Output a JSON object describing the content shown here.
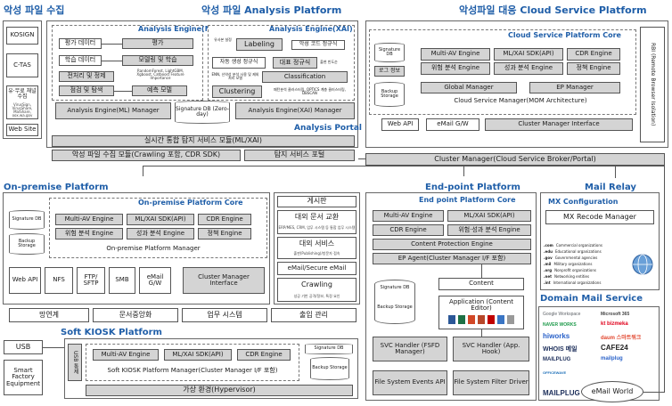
{
  "top": {
    "collect_title": "악성 파일 수집",
    "platform_title": "악성 파일 Analysis Platform",
    "cloud_title": "악성파일 대응 Cloud Service Platform"
  },
  "collect": {
    "kosign": "KOSIGN",
    "ctas": "C-TAS",
    "channel": "유·무료 채널 수집",
    "channel_sub": "VirusSign, VirusShare, MalShare, oox.wa.gov",
    "website": "Web Site"
  },
  "ml": {
    "title": "Analysis Engine(ML)",
    "eval_data": "평가 데이터",
    "eval": "평가",
    "train_data": "학습 데이터",
    "modeling": "모델링 및 학습",
    "models": "RandomForest, LightGBM, Xgboost, Catboost Feature Importance",
    "preproc": "전처리 및 정제",
    "check": "점검 및 탐색",
    "predict": "예측 모델",
    "manager": "Analysis Engine(ML) Manager"
  },
  "xai": {
    "title": "Analysis Engine(XAI)",
    "labeling_left": "유사본 설정",
    "labeling": "Labeling",
    "rule_sel": "악성 코드 정규식",
    "auto_regex": "자동 생성 정규식",
    "main_regex": "대표 정규식",
    "main_regex_sub": "출현 빈도순",
    "classif_left": "ENN, 신약성 분석 사용 및 제외 처리 모델",
    "classification": "Classification",
    "clustering": "Clustering",
    "cluster_sub": "패턴분석 클러스터링, OPTICS 계층 클러스터링, DBSCAN",
    "manager": "Analysis Engine(XAI) Manager"
  },
  "sigdb_zero": "Signature DB (Zero-day)",
  "portal": {
    "title": "Analysis Portal",
    "realtime": "실시간 통합 탐지 서비스 모듈(ML/XAI)",
    "collect_module": "악성 파일 수집 모듈(Crawling 포함, CDR SDK)",
    "detect_portal": "탐지 서비스 포털"
  },
  "cloud": {
    "core_title": "Cloud Service Platform Core",
    "sigdb": "Signature DB",
    "log": "로그 정보",
    "backup": "Backup Storage",
    "multi_av": "Multi-AV Engine",
    "mlxai": "ML/XAI SDK(API)",
    "cdr": "CDR Engine",
    "risk": "위험 분석 Engine",
    "perf": "성과 분석 Engine",
    "policy": "정책 Engine",
    "global": "Global Manager",
    "ep": "EP Manager",
    "csm": "Cloud Service Manager(MOM Architecture)",
    "webapi": "Web API",
    "email_gw": "eMail G/W",
    "cmi": "Cluster Manager Interface",
    "rbi": "RBI (Remote Browser Isolation)"
  },
  "cluster_manager": "Cluster Manager(Cloud Service Broker/Portal)",
  "onprem": {
    "title": "On-premise Platform",
    "core_title": "On-premise Platform Core",
    "sigdb": "Signature DB",
    "backup": "Backup Storage",
    "multi_av": "Multi-AV Engine",
    "mlxai": "ML/XAI SDK(API)",
    "cdr": "CDR Engine",
    "risk": "위험 분석 Engine",
    "perf": "성과 분석 Engine",
    "policy": "정책 Engine",
    "manager": "On-premise Platform Manager",
    "webapi": "Web API",
    "nfs": "NFS",
    "ftp": "FTP/ SFTP",
    "smb": "SMB",
    "email_gw": "eMail G/W",
    "cmi": "Cluster Manager Interface"
  },
  "services": {
    "board": "게시판",
    "doc_exchange": "대외 문서 교환",
    "doc_exchange_sub": "ERP/MES, CRM, 업무 시스템 등 통합 업무 시스템",
    "ext_service": "대외 서비스",
    "ext_service_sub": "출판(Publishing)/방문자 접속",
    "email_secure": "eMail/Secure eMail",
    "crawling": "Crawling",
    "crawling_sub": "성공 기반 공격/정보, 특정 요인"
  },
  "bottom_row": {
    "network": "망연계",
    "docs": "문서중앙화",
    "business": "업무 시스템",
    "access": "출입 관리"
  },
  "kiosk": {
    "title": "Soft KIOSK Platform",
    "usb": "USB",
    "smart": "Smart Factory Equipment",
    "usb_vert": "USB 통제",
    "multi_av": "Multi-AV Engine",
    "mlxai": "ML/XAI SDK(API)",
    "cdr": "CDR Engine",
    "manager": "Soft KIOSK Platform Manager(Cluster Manager I/F 포함)",
    "sigdb": "Signature DB",
    "backup": "Backup Storage",
    "hypervisor": "가상 환경(Hypervisor)"
  },
  "endpoint": {
    "title": "End-point Platform",
    "core_title": "End point Platform Core",
    "multi_av": "Multi-AV Engine",
    "mlxai": "ML/XAI SDK(API)",
    "cdr": "CDR Engine",
    "risk_perf": "위험·성과 분석 Engine",
    "cpe": "Content Protection Engine",
    "ep_agent": "EP Agent(Cluster Manager I/F 포함)",
    "sigdb": "Signature DB",
    "backup": "Backup Storage",
    "content": "Content",
    "application": "Application (Content Editor)",
    "svc_fsfd": "SVC Handler (FSFD Manager)",
    "svc_hook": "SVC Handler (App. Hook)",
    "fs_api": "File System Events API",
    "fs_driver": "File System Filter Driver"
  },
  "mail": {
    "relay_title": "Mail Relay",
    "mx_config": "MX Configuration",
    "mx_manager": "MX Recode Manager",
    "domains": [
      {
        "tld": ".com",
        "desc": "Commercial organizations"
      },
      {
        "tld": ".edu",
        "desc": "Educational organizations"
      },
      {
        "tld": ".gov",
        "desc": "Governmental agencies"
      },
      {
        "tld": ".mil",
        "desc": "Military organizations"
      },
      {
        "tld": ".org",
        "desc": "Nonprofit organizations"
      },
      {
        "tld": ".net",
        "desc": "Networking entities"
      },
      {
        "tld": ".int",
        "desc": "International organizations"
      }
    ],
    "domain_title": "Domain Mail Service",
    "providers": [
      "Google Workspace",
      "Microsoft 365",
      "NAVER WORKS",
      "kt bizmeka",
      "hiworks",
      "daum 스마트워크",
      "WHOIS 메일",
      "CAFE24",
      "MAILPLUG",
      "mailplug",
      "OFFICEWAVE",
      "MAILPLUG"
    ],
    "email_world": "eMail World"
  },
  "colors": {
    "accent": "#1f5ea8",
    "box_gray": "#d4d4d4",
    "line": "#555555"
  }
}
